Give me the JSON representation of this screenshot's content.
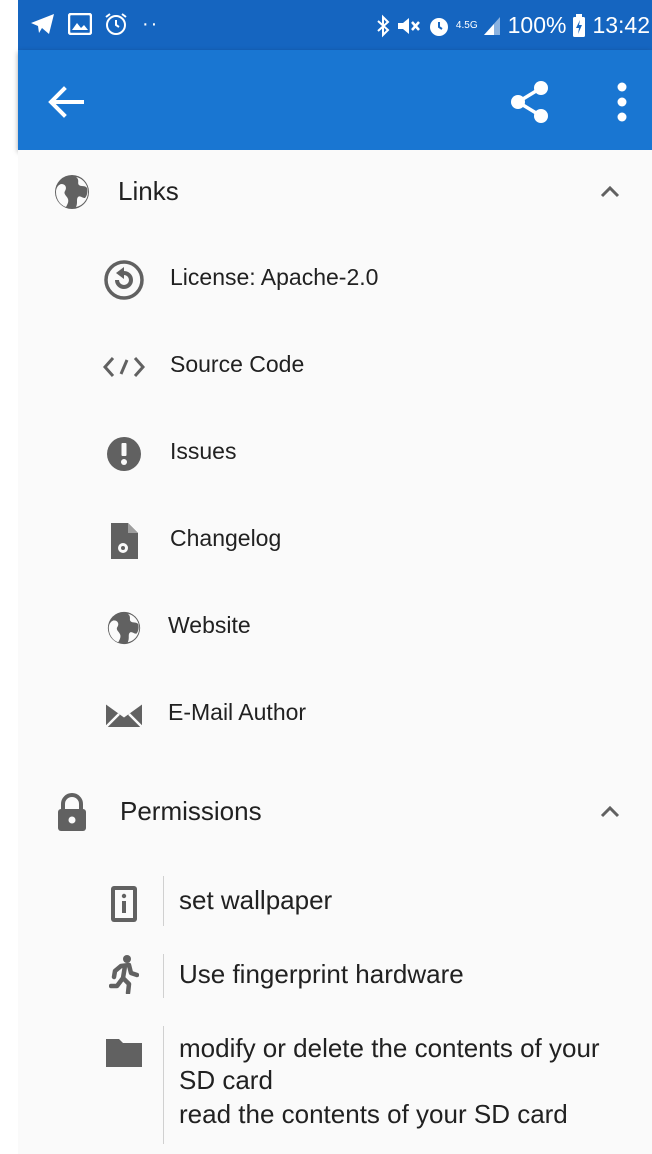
{
  "status_bar": {
    "network": "4.5G",
    "battery": "100%",
    "time": "13:42"
  },
  "app_bar": {
    "back_icon": "arrow-back-icon",
    "share_icon": "share-icon",
    "more_icon": "more-vert-icon"
  },
  "links_section": {
    "title": "Links",
    "icon": "globe-icon",
    "items": [
      {
        "label": "License: Apache-2.0",
        "icon": "copyleft-icon"
      },
      {
        "label": "Source Code",
        "icon": "code-icon"
      },
      {
        "label": "Issues",
        "icon": "alert-icon"
      },
      {
        "label": "Changelog",
        "icon": "file-settings-icon"
      },
      {
        "label": "Website",
        "icon": "globe-icon"
      },
      {
        "label": "E-Mail Author",
        "icon": "email-icon"
      }
    ]
  },
  "permissions_section": {
    "title": "Permissions",
    "icon": "lock-icon",
    "items": [
      {
        "icon": "phone-info-icon",
        "lines": [
          "set wallpaper"
        ]
      },
      {
        "icon": "running-person-icon",
        "lines": [
          "Use fingerprint hardware"
        ]
      },
      {
        "icon": "folder-icon",
        "lines": [
          "modify or delete the contents of your SD card",
          "read the contents of your SD card"
        ]
      }
    ]
  },
  "colors": {
    "status_bar": "#1565c0",
    "app_bar": "#1976d2",
    "background": "#fafafa",
    "icon": "#616161"
  }
}
